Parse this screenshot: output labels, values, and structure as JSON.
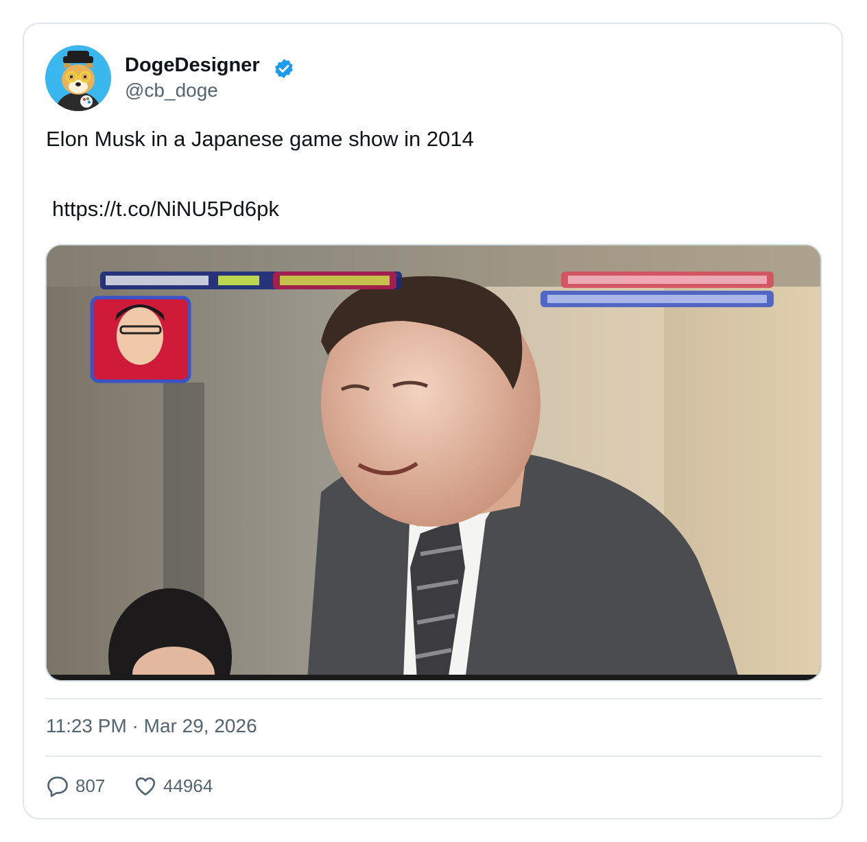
{
  "user": {
    "display_name": "DogeDesigner",
    "handle": "@cb_doge",
    "verified": true,
    "avatar_icon": "doge-avatar",
    "badge_color": "#1d9bf0"
  },
  "tweet": {
    "text": "Elon Musk in a Japanese game show in 2014",
    "link": "https://t.co/NiNU5Pd6pk",
    "timestamp": "11:23 PM · Mar 29, 2026"
  },
  "media": {
    "type": "video-still"
  },
  "actions": {
    "replies": {
      "icon": "reply-icon",
      "count": "807"
    },
    "likes": {
      "icon": "heart-icon",
      "count": "44964"
    }
  }
}
